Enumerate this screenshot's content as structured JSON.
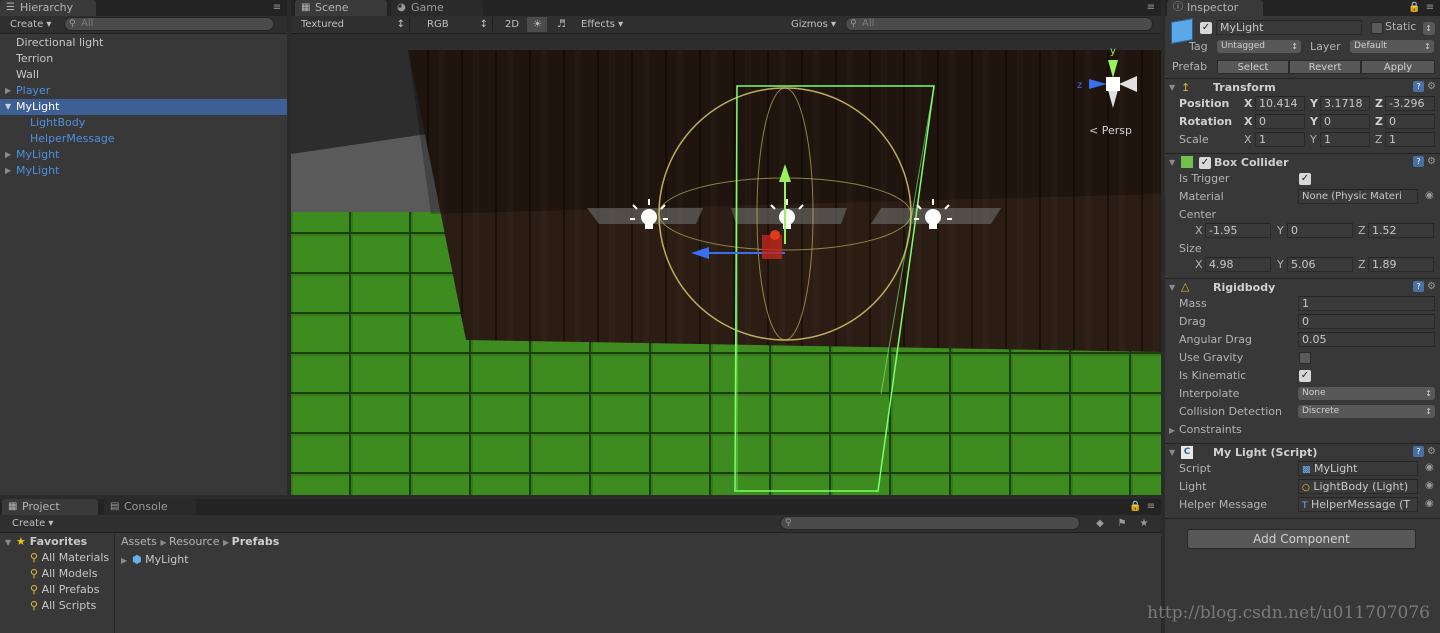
{
  "hierarchy": {
    "tab": "Hierarchy",
    "create": "Create",
    "search_placeholder": "All",
    "items": [
      {
        "label": "Directional light"
      },
      {
        "label": "Terrion"
      },
      {
        "label": "Wall"
      },
      {
        "label": "Player"
      },
      {
        "label": "MyLight"
      },
      {
        "label": "LightBody"
      },
      {
        "label": "HelperMessage"
      },
      {
        "label": "MyLight"
      },
      {
        "label": "MyLight"
      }
    ]
  },
  "scene": {
    "tabs": [
      {
        "label": "Scene"
      },
      {
        "label": "Game"
      }
    ],
    "toolbar": {
      "shading": "Textured",
      "render": "RGB",
      "mode2d": "2D",
      "effects": "Effects",
      "gizmos": "Gizmos",
      "search_placeholder": "All"
    },
    "gizmo": {
      "y": "y",
      "z": "z",
      "persp": "Persp"
    }
  },
  "inspector": {
    "tab": "Inspector",
    "object_name": "MyLight",
    "static_label": "Static",
    "tag_label": "Tag",
    "tag_value": "Untagged",
    "layer_label": "Layer",
    "layer_value": "Default",
    "prefab_label": "Prefab",
    "prefab_buttons": [
      "Select",
      "Revert",
      "Apply"
    ],
    "transform": {
      "title": "Transform",
      "position_label": "Position",
      "rotation_label": "Rotation",
      "scale_label": "Scale",
      "position": [
        "10.414",
        "3.1718",
        "-3.296"
      ],
      "rotation": [
        "0",
        "0",
        "0"
      ],
      "scale": [
        "1",
        "1",
        "1"
      ],
      "axes": [
        "X",
        "Y",
        "Z"
      ]
    },
    "box_collider": {
      "title": "Box Collider",
      "is_trigger_label": "Is Trigger",
      "material_label": "Material",
      "material_value": "None (Physic Materi",
      "center_label": "Center",
      "center": [
        "-1.95",
        "0",
        "1.52"
      ],
      "size_label": "Size",
      "size": [
        "4.98",
        "5.06",
        "1.89"
      ]
    },
    "rigidbody": {
      "title": "Rigidbody",
      "mass_label": "Mass",
      "mass": "1",
      "drag_label": "Drag",
      "drag": "0",
      "angular_drag_label": "Angular Drag",
      "angular_drag": "0.05",
      "use_gravity_label": "Use Gravity",
      "is_kinematic_label": "Is Kinematic",
      "interpolate_label": "Interpolate",
      "interpolate": "None",
      "collision_label": "Collision Detection",
      "collision": "Discrete",
      "constraints_label": "Constraints"
    },
    "script": {
      "title": "My Light (Script)",
      "script_label": "Script",
      "script_value": "MyLight",
      "light_label": "Light",
      "light_value": "LightBody (Light)",
      "helper_label": "Helper Message",
      "helper_value": "HelperMessage (T"
    },
    "add_component": "Add Component"
  },
  "project": {
    "tabs": [
      {
        "label": "Project"
      },
      {
        "label": "Console"
      }
    ],
    "create": "Create",
    "favorites": "Favorites",
    "favorite_items": [
      "All Materials",
      "All Models",
      "All Prefabs",
      "All Scripts"
    ],
    "breadcrumb": [
      "Assets",
      "Resource",
      "Prefabs"
    ],
    "assets": [
      "MyLight"
    ]
  },
  "watermark": "http://blog.csdn.net/u011707076",
  "colors": {
    "selection": "#3e5f96",
    "prefab_blue": "#4e8fe0",
    "grass": "#3f8f1e",
    "wall": "#2a1c12",
    "collider": "#7dff6a",
    "sphere": "#d9c96b"
  }
}
